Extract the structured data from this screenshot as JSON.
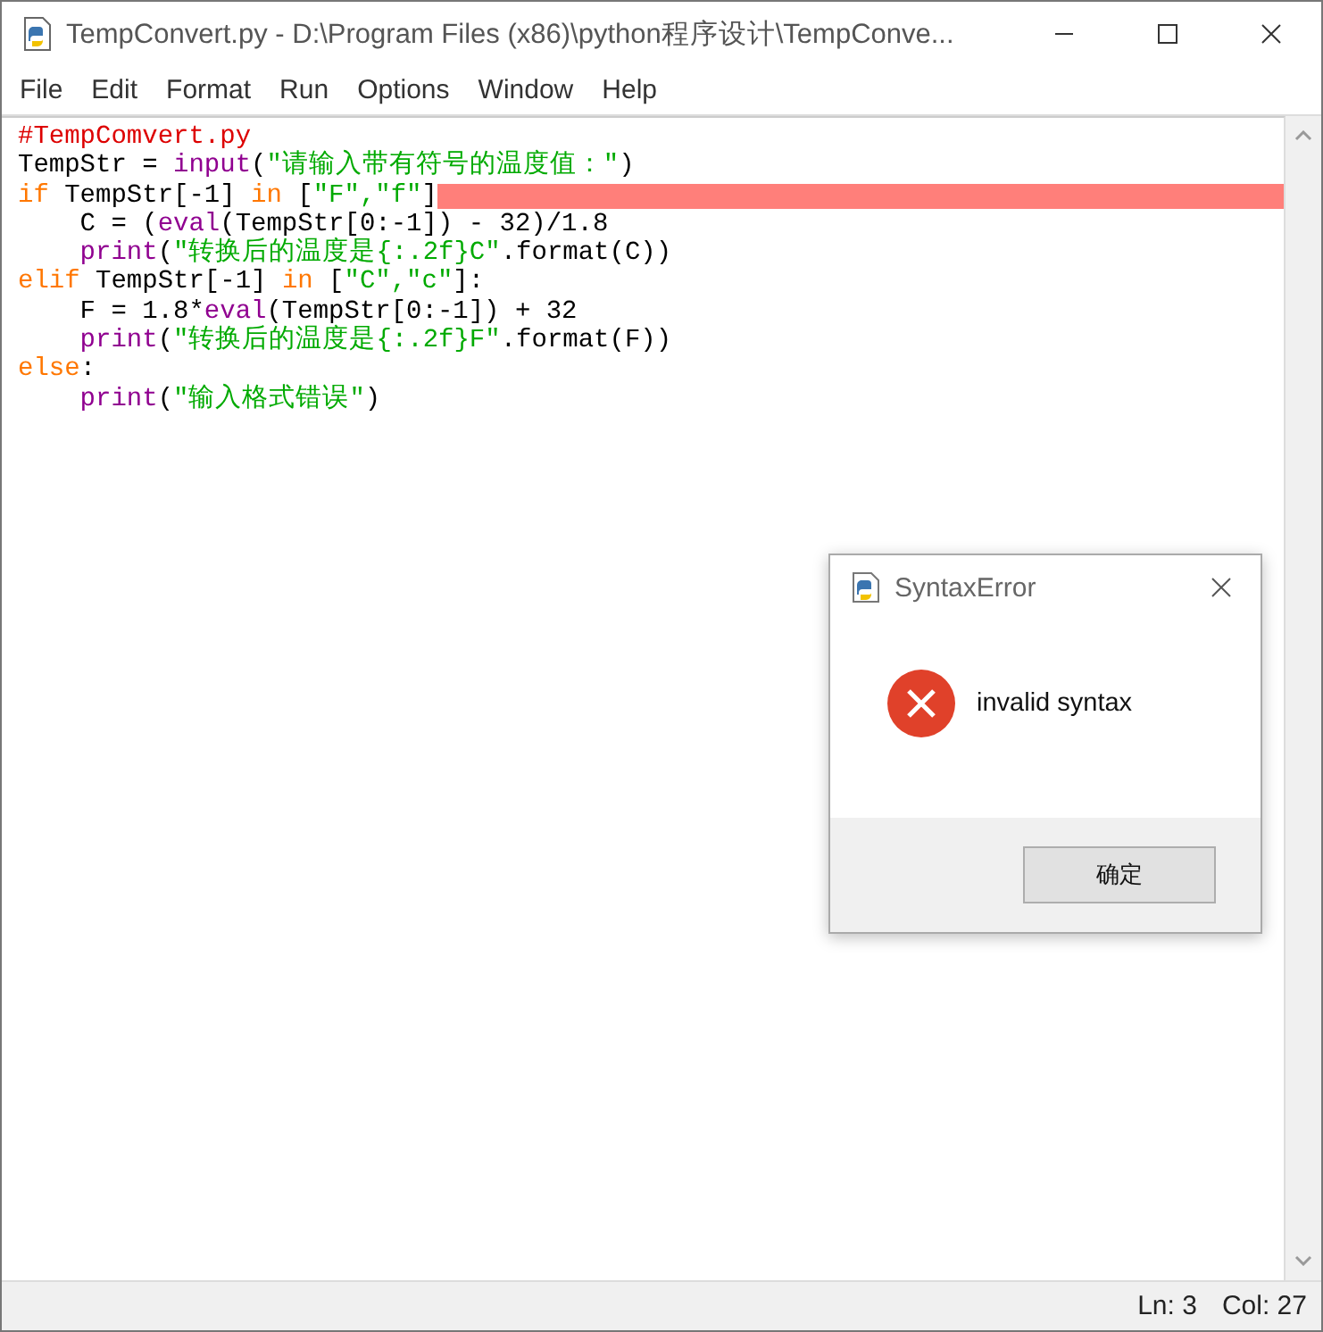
{
  "window": {
    "title": "TempConvert.py - D:\\Program Files (x86)\\python程序设计\\TempConve..."
  },
  "menu": [
    "File",
    "Edit",
    "Format",
    "Run",
    "Options",
    "Window",
    "Help"
  ],
  "code_lines": [
    {
      "indent": false,
      "error": false,
      "tokens": [
        {
          "kind": "comment",
          "text": "#TempComvert.py"
        }
      ]
    },
    {
      "indent": false,
      "error": false,
      "tokens": [
        {
          "kind": "plain",
          "text": "TempStr = "
        },
        {
          "kind": "builtin",
          "text": "input"
        },
        {
          "kind": "plain",
          "text": "("
        },
        {
          "kind": "string",
          "text": "\"请输入带有符号的温度值：\""
        },
        {
          "kind": "plain",
          "text": ")"
        }
      ]
    },
    {
      "indent": false,
      "error": true,
      "tokens": [
        {
          "kind": "keyword",
          "text": "if"
        },
        {
          "kind": "plain",
          "text": " TempStr[-1] "
        },
        {
          "kind": "keyword",
          "text": "in"
        },
        {
          "kind": "plain",
          "text": " ["
        },
        {
          "kind": "string",
          "text": "\"F\",\"f\""
        },
        {
          "kind": "plain",
          "text": "]"
        }
      ]
    },
    {
      "indent": true,
      "error": false,
      "tokens": [
        {
          "kind": "plain",
          "text": "C = ("
        },
        {
          "kind": "builtin",
          "text": "eval"
        },
        {
          "kind": "plain",
          "text": "(TempStr[0:-1]) - 32)/1.8"
        }
      ]
    },
    {
      "indent": true,
      "error": false,
      "tokens": [
        {
          "kind": "builtin",
          "text": "print"
        },
        {
          "kind": "plain",
          "text": "("
        },
        {
          "kind": "string",
          "text": "\"转换后的温度是{:.2f}C\""
        },
        {
          "kind": "plain",
          "text": ".format(C))"
        }
      ]
    },
    {
      "indent": false,
      "error": false,
      "tokens": [
        {
          "kind": "keyword",
          "text": "elif"
        },
        {
          "kind": "plain",
          "text": " TempStr[-1] "
        },
        {
          "kind": "keyword",
          "text": "in"
        },
        {
          "kind": "plain",
          "text": " ["
        },
        {
          "kind": "string",
          "text": "\"C\",\"c\""
        },
        {
          "kind": "plain",
          "text": "]:"
        }
      ]
    },
    {
      "indent": true,
      "error": false,
      "tokens": [
        {
          "kind": "plain",
          "text": "F = 1.8*"
        },
        {
          "kind": "builtin",
          "text": "eval"
        },
        {
          "kind": "plain",
          "text": "(TempStr[0:-1]) + 32"
        }
      ]
    },
    {
      "indent": true,
      "error": false,
      "tokens": [
        {
          "kind": "builtin",
          "text": "print"
        },
        {
          "kind": "plain",
          "text": "("
        },
        {
          "kind": "string",
          "text": "\"转换后的温度是{:.2f}F\""
        },
        {
          "kind": "plain",
          "text": ".format(F))"
        }
      ]
    },
    {
      "indent": false,
      "error": false,
      "tokens": [
        {
          "kind": "keyword",
          "text": "else"
        },
        {
          "kind": "plain",
          "text": ":"
        }
      ]
    },
    {
      "indent": true,
      "error": false,
      "tokens": [
        {
          "kind": "builtin",
          "text": "print"
        },
        {
          "kind": "plain",
          "text": "("
        },
        {
          "kind": "string",
          "text": "\"输入格式错误\""
        },
        {
          "kind": "plain",
          "text": ")"
        }
      ]
    }
  ],
  "status_bar": {
    "line": "Ln: 3",
    "column": "Col: 27"
  },
  "dialog": {
    "title": "SyntaxError",
    "message": "invalid syntax",
    "button": "确定"
  }
}
